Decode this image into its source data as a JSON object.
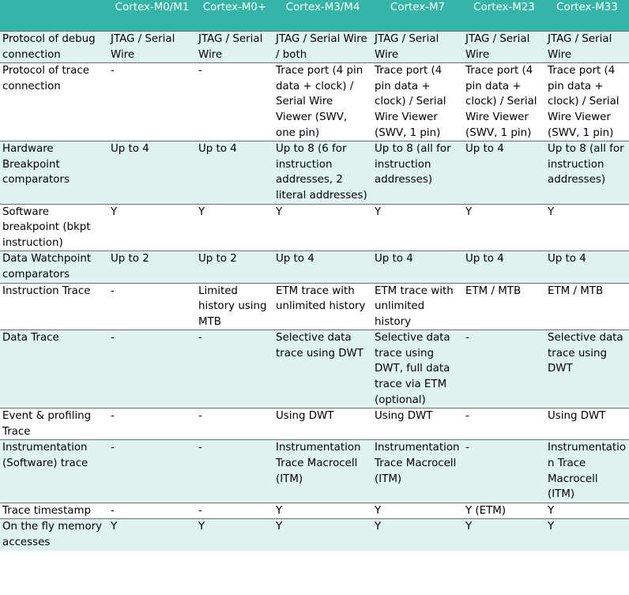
{
  "table": {
    "headers": [
      "",
      "Cortex-M0/M1",
      "Cortex-M0+",
      "Cortex-M3/M4",
      "Cortex-M7",
      "Cortex-M23",
      "Cortex-M33"
    ],
    "rows": [
      {
        "label": "Protocol of debug connection",
        "cells": [
          "JTAG / Serial Wire",
          "JTAG / Serial Wire",
          "JTAG / Serial Wire / both",
          "JTAG / Serial Wire",
          "JTAG / Serial Wire",
          "JTAG / Serial Wire"
        ]
      },
      {
        "label": "Protocol of trace connection",
        "cells": [
          "-",
          "-",
          "Trace port (4 pin data + clock) / Serial Wire Viewer (SWV, one pin)",
          "Trace port (4 pin data + clock) / Serial Wire Viewer (SWV, 1 pin)",
          "Trace port (4 pin data + clock) / Serial Wire Viewer (SWV, 1 pin)",
          "Trace port (4 pin data + clock) / Serial Wire Viewer (SWV, 1 pin)"
        ]
      },
      {
        "label": "Hardware Breakpoint comparators",
        "cells": [
          "Up to 4",
          "Up to 4",
          "Up to 8 (6 for instruction addresses, 2 literal addresses)",
          "Up to 8 (all for instruction addresses)",
          "Up to 4",
          "Up to 8 (all for instruction addresses)"
        ]
      },
      {
        "label": "Software breakpoint (bkpt instruction)",
        "cells": [
          "Y",
          "Y",
          "Y",
          "Y",
          "Y",
          "Y"
        ]
      },
      {
        "label": "Data Watchpoint comparators",
        "cells": [
          "Up to 2",
          "Up to 2",
          "Up to 4",
          "Up to 4",
          "Up to 4",
          "Up to 4"
        ]
      },
      {
        "label": "Instruction Trace",
        "cells": [
          "-",
          "Limited history using MTB",
          "ETM trace with unlimited history",
          "ETM trace with unlimited history",
          "ETM / MTB",
          "ETM / MTB"
        ]
      },
      {
        "label": "Data Trace",
        "cells": [
          "-",
          "-",
          "Selective data trace using DWT",
          "Selective data trace using DWT, full data trace via ETM (optional)",
          "-",
          "Selective data trace using DWT"
        ]
      },
      {
        "label": "Event & profiling Trace",
        "cells": [
          "-",
          "-",
          "Using DWT",
          "Using DWT",
          "-",
          "Using DWT"
        ]
      },
      {
        "label": "Instrumentation (Software) trace",
        "cells": [
          "-",
          "-",
          "Instrumentation Trace Macrocell (ITM)",
          "Instrumentation Trace Macrocell (ITM)",
          "-",
          "Instrumentation Trace Macrocell (ITM)"
        ]
      },
      {
        "label": "Trace timestamp",
        "cells": [
          "-",
          "-",
          "Y",
          "Y",
          "Y (ETM)",
          "Y"
        ]
      },
      {
        "label": "On the fly memory accesses",
        "cells": [
          "Y",
          "Y",
          "Y",
          "Y",
          "Y",
          "Y"
        ]
      }
    ]
  }
}
